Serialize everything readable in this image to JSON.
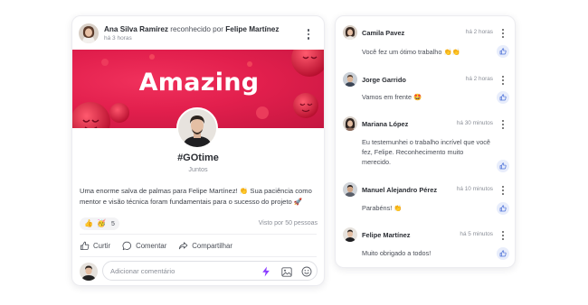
{
  "post": {
    "author": "Ana Silva Ramírez",
    "recognized_text": "reconhecido por",
    "recognizer": "Felipe Martínez",
    "time_ago": "há 3 horas",
    "banner_text": "Amazing",
    "badge_title": "#GOtime",
    "badge_subtitle": "Juntos",
    "body": "Uma enorme salva de palmas para Felipe Martínez! 👏 Sua paciência como mentor e visão técnica foram fundamentais para o sucesso do projeto 🚀",
    "reactions": {
      "emojis": [
        "👍",
        "🥳"
      ],
      "count": "5"
    },
    "views": "Visto por 50 pessoas",
    "actions": {
      "like": "Curtir",
      "comment": "Comentar",
      "share": "Compartilhar"
    },
    "comment_placeholder": "Adicionar comentário"
  },
  "comments": [
    {
      "name": "Camila Pavez",
      "time": "há 2 horas",
      "text": "Você fez um ótimo trabalho 👏👏"
    },
    {
      "name": "Jorge Garrido",
      "time": "há 2 horas",
      "text": "Vamos em frente 🤩"
    },
    {
      "name": "Mariana López",
      "time": "há 30 minutos",
      "text": "Eu testemunhei o trabalho incrível que você fez, Felipe. Reconhecimento muito merecido."
    },
    {
      "name": "Manuel Alejandro Pérez",
      "time": "há 10 minutos",
      "text": "Parabéns! 👏"
    },
    {
      "name": "Felipe Martínez",
      "time": "há 5 minutos",
      "text": "Muito obrigado a todos!"
    }
  ],
  "colors": {
    "banner": "#e21f4d",
    "accent_purple": "#8b3dff",
    "like_button_bg": "#e8edfb",
    "like_button_icon": "#4a6fd8"
  }
}
